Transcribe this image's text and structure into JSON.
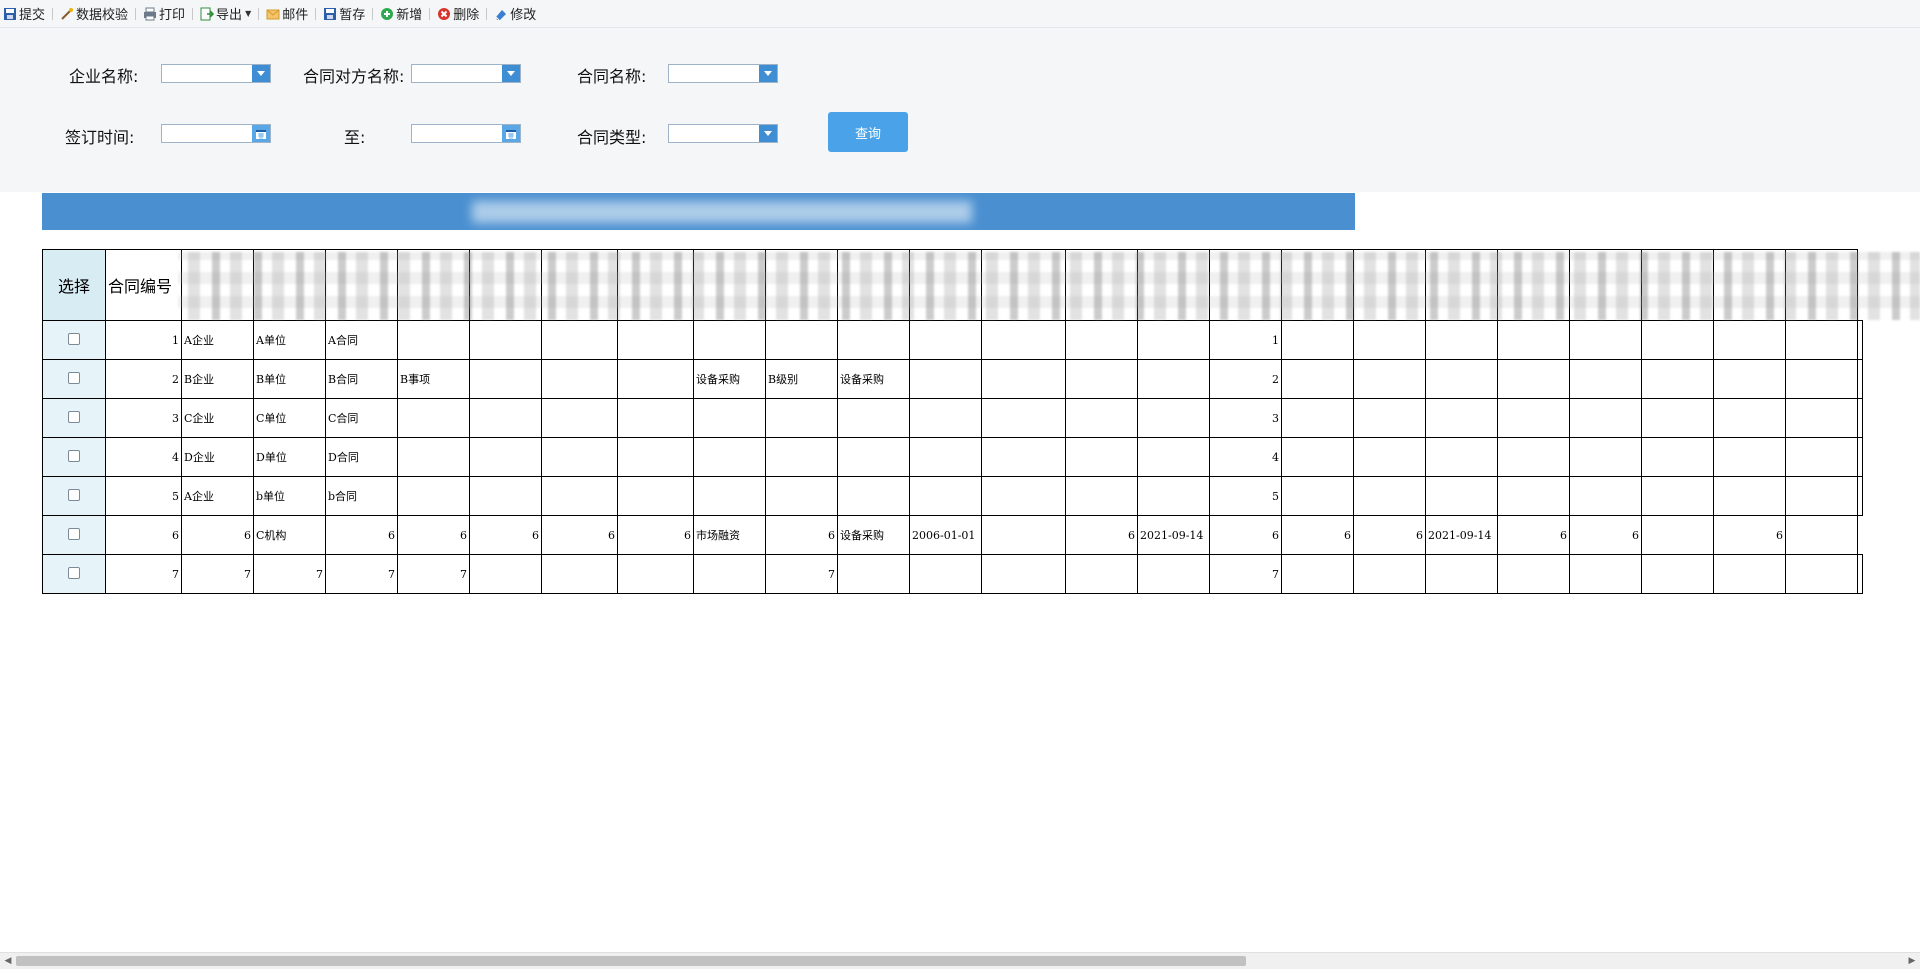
{
  "toolbar": {
    "submit": "提交",
    "validate": "数据校验",
    "print": "打印",
    "export": "导出",
    "mail": "邮件",
    "save_draft": "暂存",
    "add": "新增",
    "delete": "删除",
    "edit": "修改"
  },
  "filters": {
    "company_label": "企业名称:",
    "counterparty_label": "合同对方名称:",
    "contract_name_label": "合同名称:",
    "sign_date_label": "签订时间:",
    "to_label": "至:",
    "contract_type_label": "合同类型:",
    "query_button": "查询"
  },
  "table": {
    "headers": {
      "select": "选择",
      "contract_no": "合同编号"
    },
    "rows": [
      [
        "1",
        "A企业",
        "A单位",
        "A合同",
        "",
        "",
        "",
        "",
        "",
        "",
        "",
        "",
        "",
        "",
        "",
        "1",
        "",
        "",
        "",
        "",
        "",
        "",
        "",
        "",
        ""
      ],
      [
        "2",
        "B企业",
        "B单位",
        "B合同",
        "B事项",
        "",
        "",
        "",
        "设备采购",
        "B级别",
        "设备采购",
        "",
        "",
        "",
        "",
        "2",
        "",
        "",
        "",
        "",
        "",
        "",
        "",
        "",
        ""
      ],
      [
        "3",
        "C企业",
        "C单位",
        "C合同",
        "",
        "",
        "",
        "",
        "",
        "",
        "",
        "",
        "",
        "",
        "",
        "3",
        "",
        "",
        "",
        "",
        "",
        "",
        "",
        "",
        ""
      ],
      [
        "4",
        "D企业",
        "D单位",
        "D合同",
        "",
        "",
        "",
        "",
        "",
        "",
        "",
        "",
        "",
        "",
        "",
        "4",
        "",
        "",
        "",
        "",
        "",
        "",
        "",
        "",
        ""
      ],
      [
        "5",
        "A企业",
        "b单位",
        "b合同",
        "",
        "",
        "",
        "",
        "",
        "",
        "",
        "",
        "",
        "",
        "",
        "5",
        "",
        "",
        "",
        "",
        "",
        "",
        "",
        "",
        ""
      ],
      [
        "6",
        "6",
        "C机构",
        "6",
        "6",
        "6",
        "6",
        "6",
        "市场融资",
        "6",
        "设备采购",
        "2006-01-01",
        "",
        "6",
        "2021-09-14",
        "6",
        "6",
        "6",
        "2021-09-14",
        "6",
        "6",
        "",
        "6",
        ""
      ],
      [
        "7",
        "7",
        "7",
        "7",
        "7",
        "",
        "",
        "",
        "",
        "7",
        "",
        "",
        "",
        "",
        "",
        "7",
        "",
        "",
        "",
        "",
        "",
        "",
        "",
        "",
        ""
      ]
    ]
  }
}
